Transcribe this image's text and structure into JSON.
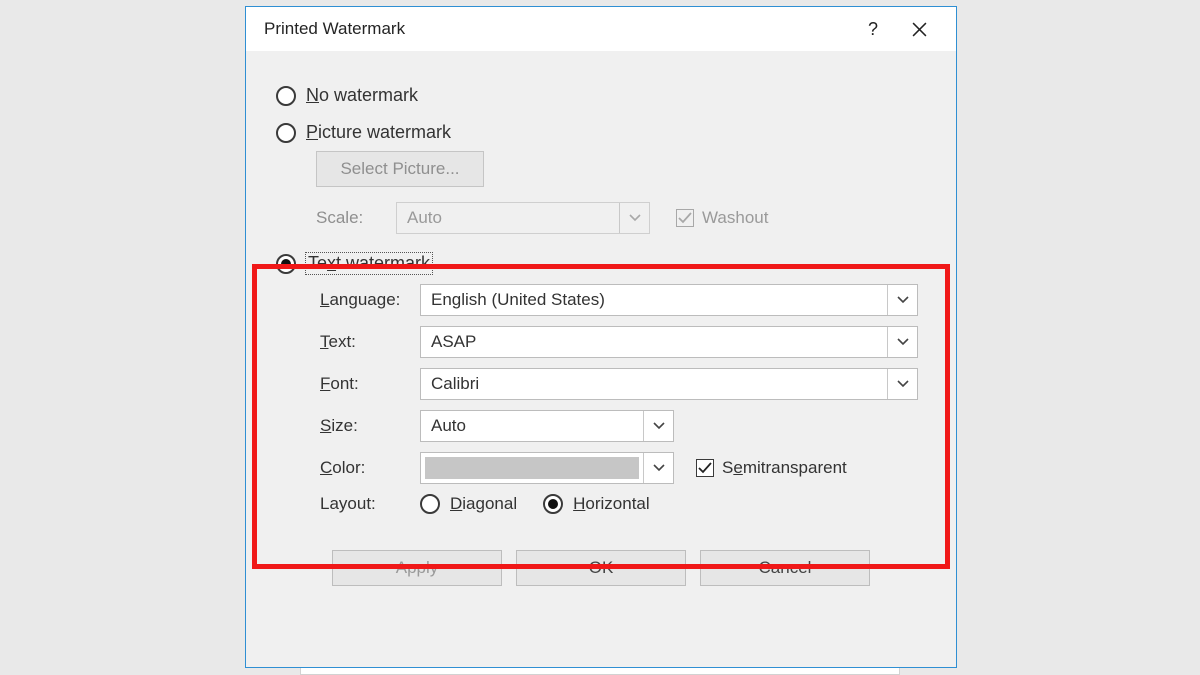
{
  "dialog": {
    "title": "Printed Watermark"
  },
  "radios": {
    "no_label": "o watermark",
    "no_prefix": "N",
    "pic_prefix": "P",
    "pic_label": "icture watermark",
    "text_prefix": "x",
    "text_before": "Te",
    "text_after": "t watermark"
  },
  "picture": {
    "button": "Select Picture...",
    "scale_label": "Scale:",
    "scale_value": "Auto",
    "washout_label": "Washout"
  },
  "fields": {
    "language_prefix": "L",
    "language_label": "anguage:",
    "language_value": "English (United States)",
    "text_prefix": "T",
    "text_label": "ext:",
    "text_value": "ASAP",
    "font_prefix": "F",
    "font_label": "ont:",
    "font_value": "Calibri",
    "size_prefix": "S",
    "size_label": "ize:",
    "size_value": "Auto",
    "color_prefix": "C",
    "color_label": "olor:",
    "semi_prefix": "e",
    "semi_before": "S",
    "semi_after": "mitransparent",
    "layout_label": "Layout:",
    "diag_prefix": "D",
    "diag_label": "iagonal",
    "horiz_prefix": "H",
    "horiz_label": "orizontal"
  },
  "buttons": {
    "apply": "Apply",
    "ok": "OK",
    "cancel": "Cancel"
  }
}
